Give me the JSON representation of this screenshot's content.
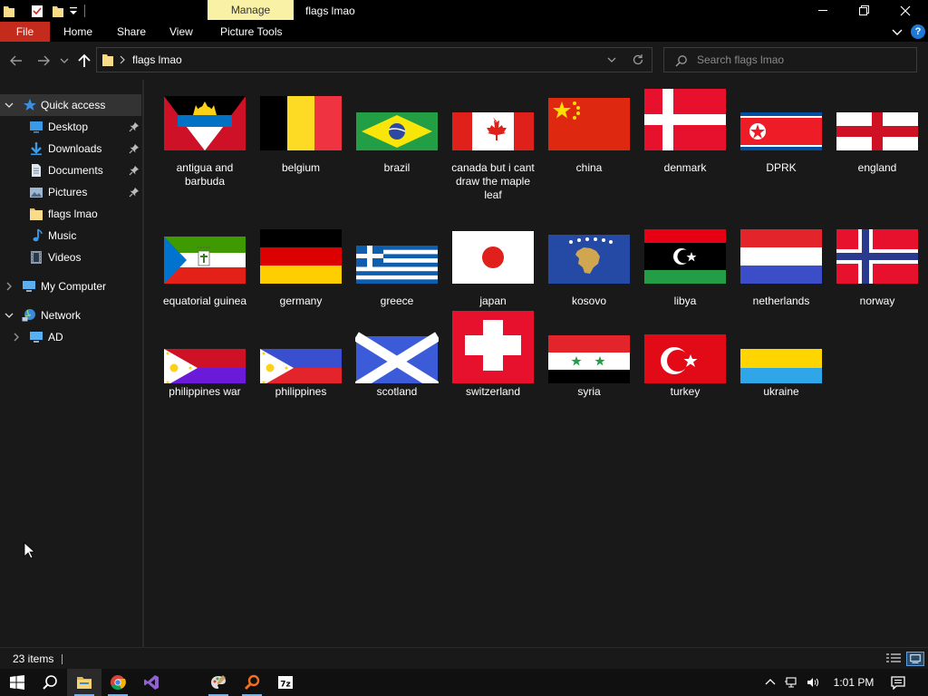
{
  "titlebar": {
    "context_tab": "Manage",
    "window_title": "flags lmao"
  },
  "ribbon": {
    "file": "File",
    "home": "Home",
    "share": "Share",
    "view": "View",
    "picture_tools": "Picture Tools"
  },
  "address": {
    "path": "flags lmao"
  },
  "search": {
    "placeholder": "Search flags lmao"
  },
  "sidebar": {
    "quick_access": "Quick access",
    "desktop": "Desktop",
    "downloads": "Downloads",
    "documents": "Documents",
    "pictures": "Pictures",
    "flags": "flags lmao",
    "music": "Music",
    "videos": "Videos",
    "my_computer": "My Computer",
    "network": "Network",
    "ad": "AD"
  },
  "files": [
    "antigua and barbuda",
    "belgium",
    "brazil",
    "canada but i cant draw the maple leaf",
    "china",
    "denmark",
    "DPRK",
    "england",
    "equatorial guinea",
    "germany",
    "greece",
    "japan",
    "kosovo",
    "libya",
    "netherlands",
    "norway",
    "philippines war",
    "philippines",
    "scotland",
    "switzerland",
    "syria",
    "turkey",
    "ukraine"
  ],
  "status": {
    "count": "23 items"
  },
  "taskbar": {
    "time": "1:01 PM"
  },
  "colors": {
    "accent_file_tab": "#c42b1c",
    "manage_tab": "#f9f1a5",
    "background": "#191919",
    "selection": "#333333"
  }
}
